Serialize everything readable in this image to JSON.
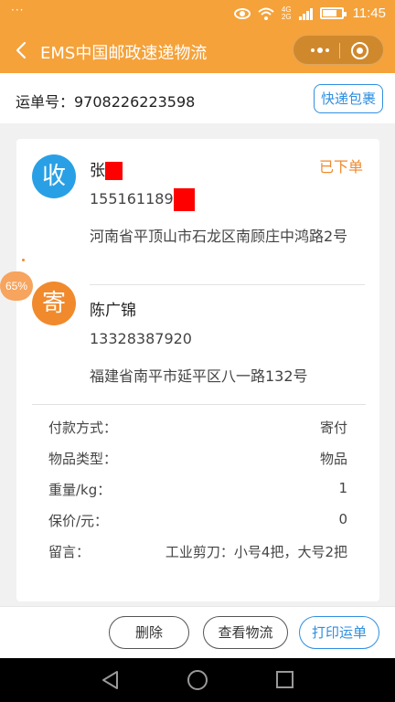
{
  "status_bar": {
    "menu_dots": "···",
    "network_top": "4G",
    "network_bottom": "2G",
    "time": "11:45"
  },
  "nav": {
    "title": "EMS中国邮政速递物流"
  },
  "waybill": {
    "label_with_number": "运单号：9708226223598",
    "track_button": "快递包裹"
  },
  "receiver": {
    "avatar_char": "收",
    "name_visible": "张",
    "phone_visible": "155161189",
    "address": "河南省平顶山市石龙区南顾庄中鸿路2号",
    "status": "已下单"
  },
  "sender": {
    "avatar_char": "寄",
    "name": "陈广锦",
    "phone": "13328387920",
    "address": "福建省南平市延平区八一路132号"
  },
  "progress_badge": "65%",
  "details": [
    {
      "label": "付款方式：",
      "value": "寄付"
    },
    {
      "label": "物品类型：",
      "value": "物品"
    },
    {
      "label": "重量/kg：",
      "value": "1"
    },
    {
      "label": "保价/元：",
      "value": "0"
    },
    {
      "label": "留言：",
      "value": "工业剪刀：小号4把，大号2把"
    }
  ],
  "actions": {
    "delete": "删除",
    "view_logistics": "查看物流",
    "print_waybill": "打印运单"
  },
  "colors": {
    "brand_orange": "#f5a23a",
    "accent_blue": "#2f8fe0",
    "receiver_blue": "#29a0e5",
    "sender_orange": "#f08a2c",
    "redaction_red": "#ff0000"
  }
}
